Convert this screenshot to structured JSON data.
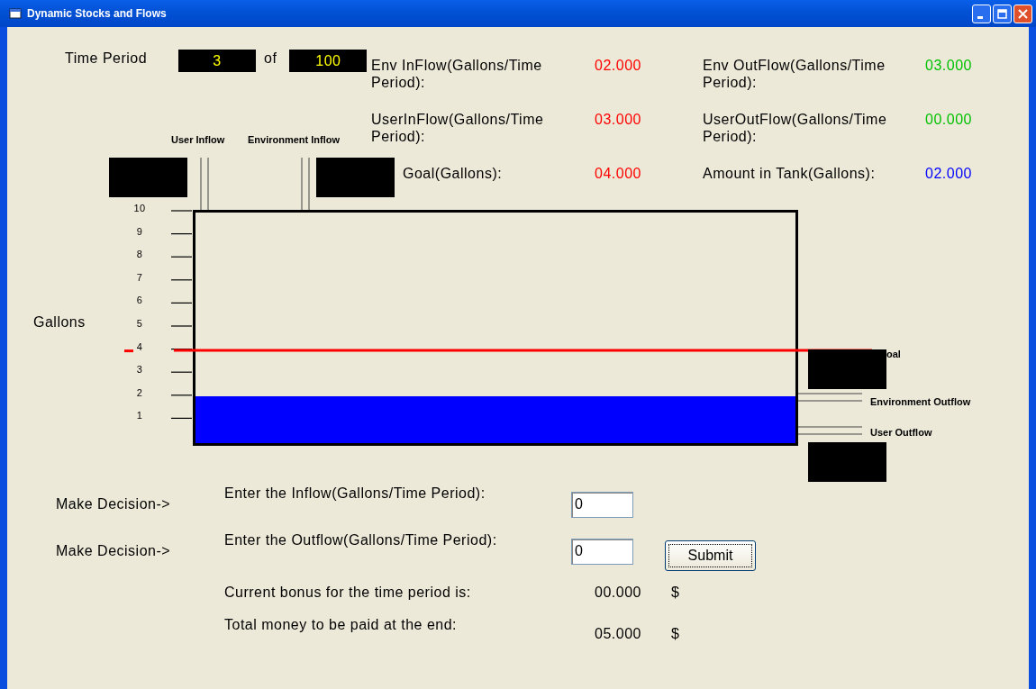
{
  "window": {
    "title": "Dynamic Stocks and Flows"
  },
  "time_period": {
    "label": "Time Period",
    "current": "3",
    "separator": "of",
    "total": "100"
  },
  "stats": [
    {
      "kind": "flow",
      "label": "Env InFlow(Gallons/Time Period):",
      "value": "02.000",
      "color": "#ff0000",
      "indent": false
    },
    {
      "kind": "flow",
      "label": "Env OutFlow(Gallons/Time Period):",
      "value": "03.000",
      "color": "#00c000",
      "indent": false
    },
    {
      "kind": "flow",
      "label": "UserInFlow(Gallons/Time Period):",
      "value": "03.000",
      "color": "#ff0000",
      "indent": false
    },
    {
      "kind": "flow",
      "label": "UserOutFlow(Gallons/Time Period):",
      "value": "00.000",
      "color": "#00c000",
      "indent": false
    },
    {
      "kind": "goal",
      "label": "Goal(Gallons):",
      "value": "04.000",
      "color": "#ff0000",
      "indent": true
    },
    {
      "kind": "amount",
      "label": "Amount in Tank(Gallons):",
      "value": "02.000",
      "color": "#0000ff",
      "indent": false
    }
  ],
  "tank": {
    "axis_label": "Gallons",
    "scale": [
      "10",
      "9",
      "8",
      "7",
      "6",
      "5",
      "4",
      "3",
      "2",
      "1"
    ],
    "inflow_labels": [
      "User Inflow",
      "Environment Inflow"
    ],
    "goal_label": "oal",
    "outflow_labels": [
      "Environment Outflow",
      "User Outflow"
    ]
  },
  "decisions": [
    {
      "prompt": "Make Decision->",
      "label": "Enter the Inflow(Gallons/Time Period):",
      "value": "0"
    },
    {
      "prompt": "Make Decision->",
      "label": "Enter the Outflow(Gallons/Time Period):",
      "value": "0"
    }
  ],
  "submit": "Submit",
  "totals": [
    {
      "label": "Current bonus for the time period is:",
      "value": "00.000",
      "unit": "$"
    },
    {
      "label": "Total money to be paid at the end:",
      "value": "05.000",
      "unit": "$"
    }
  ]
}
